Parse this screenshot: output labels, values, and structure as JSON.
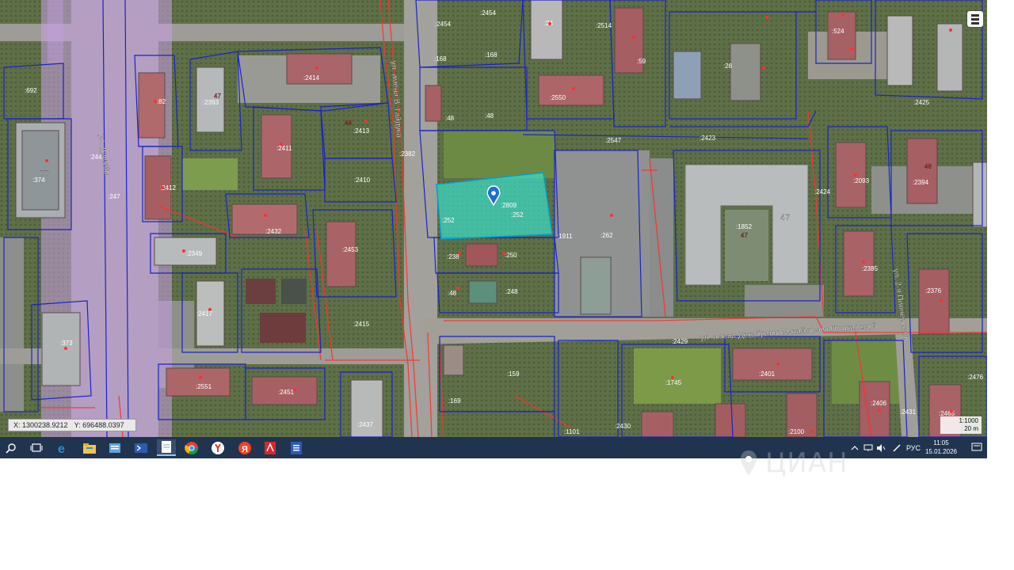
{
  "map": {
    "streets": {
      "druzhby": "ул. Дружбы",
      "gaiduka": "ул. имени В. Гайдука",
      "pushkarevoy": "ул. имени Декабрины Михайловны Пушкаревой",
      "pionerskaya": "ул. 2-я Пионерская"
    },
    "cadastral_labels": {
      "l1": ":2454",
      "l2": ":2454",
      "l3": ":168",
      "l4": ":168",
      "l5": ":24",
      "l6": ":2514",
      "l7": ":59",
      "l8": ":28",
      "l9": ":524",
      "l10": ":692",
      "l11": ":2414",
      "l12": ":2393",
      "l13": ":82",
      "l14": ":48",
      "l15": ":48",
      "l16": ":2550",
      "l17": ":2425",
      "l18": ":2413",
      "l19": ":2411",
      "l20": ":2412",
      "l21": ":2410",
      "l22": ":374",
      "l23": ":244",
      "l24": ":247",
      "l25": ":2547",
      "l26": ":2423",
      "l27": ":2093",
      "l28": ":2394",
      "l29": ":2424",
      "l30": ":2432",
      "l31": ":252",
      "l32": ":252",
      "l33": ":2809",
      "l34": ":1911",
      "l35": ":262",
      "l36": ":1852",
      "l37": ":2385",
      "l38": ":2376",
      "l39": ":2349",
      "l40": ":2453",
      "l41": ":238",
      "l42": ":250",
      "l43": ":2415",
      "l44": ":48",
      "l45": ":248",
      "l46": ":2429",
      "l47": ":373",
      "l48": ":2417",
      "l49": ":2401",
      "l50": ":2551",
      "l51": ":2451",
      "l52": ":159",
      "l53": ":169",
      "l54": ":2437",
      "l55": ":2431",
      "l56": ":2406",
      "l57": ":2465",
      "l58": ":2476",
      "l59": ":1101",
      "l60": ":2430",
      "l61": ":2100",
      "l62": ":1745",
      "l63": ":2382"
    },
    "house_numbers": {
      "h1": "77",
      "h2": "47",
      "h3": "47",
      "h4": "48",
      "h5": "47",
      "h6": "44"
    },
    "coords": {
      "x_label": "X: 1300238.9212",
      "y_label": "Y: 696488.0397"
    },
    "scale": {
      "ratio": "1:1000",
      "distance": "20 m"
    },
    "parcel_color": "#37e6d3",
    "parcel_border": "#00a0c8",
    "boundary_color": "#1a23c8",
    "zone_color": "#ff3030",
    "road_zone_color": "#c8a0e6"
  },
  "taskbar": {
    "apps": [
      "search-icon",
      "task-view-icon",
      "edge-icon",
      "explorer-icon",
      "file-viewer-icon",
      "powershell-icon",
      "notepad-icon",
      "chrome-icon",
      "yandex-browser-icon",
      "yandex-icon",
      "acrobat-icon",
      "word-icon"
    ],
    "language": "РУС",
    "time": "11:05",
    "date": "15.01.2026",
    "accent": "#20344f"
  },
  "watermark": {
    "text": "ЦИАН"
  }
}
